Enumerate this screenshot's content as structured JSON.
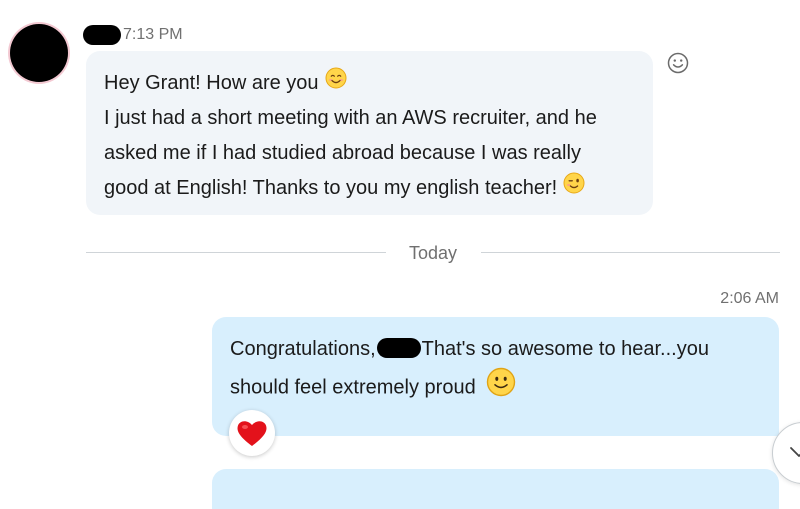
{
  "incoming": {
    "time": "7:13 PM",
    "lines": [
      "Hey Grant! How are you",
      "I just had a short meeting with an AWS recruiter, and he",
      "asked me if I had studied abroad because I was really",
      "good at English! Thanks to you my english teacher!"
    ],
    "emojis": [
      "smiling-face-icon",
      "winking-face-icon"
    ]
  },
  "divider": {
    "label": "Today"
  },
  "outgoing": {
    "time": "2:06 AM",
    "line1_before": "Congratulations,",
    "line1_after": "That's so awesome to hear...you",
    "line2": "should feel extremely proud",
    "emoji": "smiley-face-icon",
    "reaction": "heart-icon"
  },
  "icons": {
    "react": "emoji-reaction-icon",
    "scroll": "chevron-down-icon"
  },
  "colors": {
    "incoming_bubble": "#f1f5f9",
    "outgoing_bubble": "#d8effd",
    "meta_text": "#707070",
    "avatar_ring": "#f3c9d2"
  }
}
